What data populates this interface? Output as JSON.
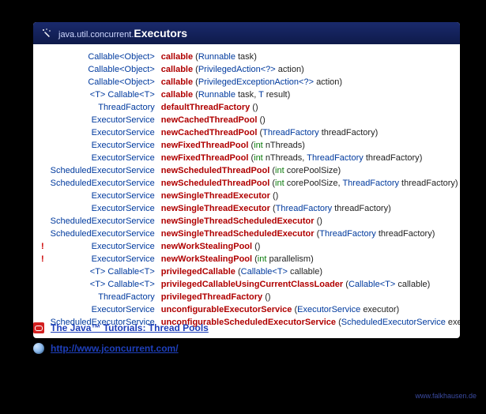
{
  "header": {
    "package": "java.util.concurrent.",
    "class": "Executors"
  },
  "methods": [
    {
      "flag": "",
      "ret_plain": "Callable",
      "ret_generic": "<Object>",
      "name": "callable",
      "params": [
        {
          "t": "Runnable",
          "n": "task"
        }
      ]
    },
    {
      "flag": "",
      "ret_plain": "Callable",
      "ret_generic": "<Object>",
      "name": "callable",
      "params": [
        {
          "t": "PrivilegedAction",
          "g": "<?>",
          "n": "action"
        }
      ]
    },
    {
      "flag": "",
      "ret_plain": "Callable",
      "ret_generic": "<Object>",
      "name": "callable",
      "params": [
        {
          "t": "PrivilegedExceptionAction",
          "g": "<?>",
          "n": "action"
        }
      ]
    },
    {
      "flag": "",
      "ret_prefix": "<T>",
      "ret_plain": "Callable",
      "ret_generic": "<T>",
      "name": "callable",
      "params": [
        {
          "t": "Runnable",
          "n": "task"
        },
        {
          "t": "T",
          "n": "result"
        }
      ]
    },
    {
      "flag": "",
      "ret_plain": "ThreadFactory",
      "name": "defaultThreadFactory",
      "params": []
    },
    {
      "flag": "",
      "ret_plain": "ExecutorService",
      "name": "newCachedThreadPool",
      "params": []
    },
    {
      "flag": "",
      "ret_plain": "ExecutorService",
      "name": "newCachedThreadPool",
      "params": [
        {
          "t": "ThreadFactory",
          "n": "threadFactory"
        }
      ]
    },
    {
      "flag": "",
      "ret_plain": "ExecutorService",
      "name": "newFixedThreadPool",
      "params": [
        {
          "pt": "int",
          "n": "nThreads"
        }
      ]
    },
    {
      "flag": "",
      "ret_plain": "ExecutorService",
      "name": "newFixedThreadPool",
      "params": [
        {
          "pt": "int",
          "n": "nThreads"
        },
        {
          "t": "ThreadFactory",
          "n": "threadFactory"
        }
      ]
    },
    {
      "flag": "",
      "ret_plain": "ScheduledExecutorService",
      "name": "newScheduledThreadPool",
      "params": [
        {
          "pt": "int",
          "n": "corePoolSize"
        }
      ]
    },
    {
      "flag": "",
      "ret_plain": "ScheduledExecutorService",
      "name": "newScheduledThreadPool",
      "params": [
        {
          "pt": "int",
          "n": "corePoolSize"
        },
        {
          "t": "ThreadFactory",
          "n": "threadFactory"
        }
      ]
    },
    {
      "flag": "",
      "ret_plain": "ExecutorService",
      "name": "newSingleThreadExecutor",
      "params": []
    },
    {
      "flag": "",
      "ret_plain": "ExecutorService",
      "name": "newSingleThreadExecutor",
      "params": [
        {
          "t": "ThreadFactory",
          "n": "threadFactory"
        }
      ]
    },
    {
      "flag": "",
      "ret_plain": "ScheduledExecutorService",
      "name": "newSingleThreadScheduledExecutor",
      "params": []
    },
    {
      "flag": "",
      "ret_plain": "ScheduledExecutorService",
      "name": "newSingleThreadScheduledExecutor",
      "params": [
        {
          "t": "ThreadFactory",
          "n": "threadFactory"
        }
      ]
    },
    {
      "flag": "!",
      "ret_plain": "ExecutorService",
      "name": "newWorkStealingPool",
      "params": []
    },
    {
      "flag": "!",
      "ret_plain": "ExecutorService",
      "name": "newWorkStealingPool",
      "params": [
        {
          "pt": "int",
          "n": "parallelism"
        }
      ]
    },
    {
      "flag": "",
      "ret_prefix": "<T>",
      "ret_plain": "Callable",
      "ret_generic": "<T>",
      "name": "privilegedCallable",
      "params": [
        {
          "t": "Callable",
          "g": "<T>",
          "n": "callable"
        }
      ]
    },
    {
      "flag": "",
      "ret_prefix": "<T>",
      "ret_plain": "Callable",
      "ret_generic": "<T>",
      "name": "privilegedCallableUsingCurrentClassLoader",
      "params": [
        {
          "t": "Callable",
          "g": "<T>",
          "n": "callable"
        }
      ]
    },
    {
      "flag": "",
      "ret_plain": "ThreadFactory",
      "name": "privilegedThreadFactory",
      "params": []
    },
    {
      "flag": "",
      "ret_plain": "ExecutorService",
      "name": "unconfigurableExecutorService",
      "params": [
        {
          "t": "ExecutorService",
          "n": "executor"
        }
      ]
    },
    {
      "flag": "",
      "ret_plain": "ScheduledExecutorService",
      "name": "unconfigurableScheduledExecutorService",
      "params": [
        {
          "t": "ScheduledExecutorService",
          "n": "executor"
        }
      ]
    }
  ],
  "footer": {
    "link1": "The Java™ Tutorials: Thread Pools",
    "link2": "http://www.jconcurrent.com/"
  },
  "attribution": "www.falkhausen.de"
}
